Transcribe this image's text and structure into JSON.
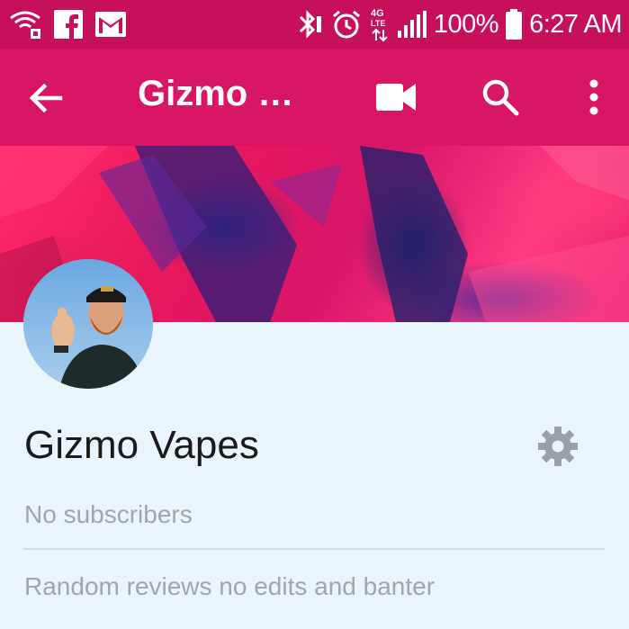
{
  "status_bar": {
    "battery": "100%",
    "time": "6:27 AM",
    "network": "4G LTE",
    "icons": [
      "wifi-call-icon",
      "facebook-icon",
      "gmail-icon",
      "bluetooth-icon",
      "alarm-icon",
      "lte-icon",
      "signal-icon",
      "battery-icon"
    ]
  },
  "app_bar": {
    "title": "Gizmo V…",
    "icons": [
      "back-arrow-icon",
      "video-camera-icon",
      "search-icon",
      "more-vert-icon"
    ]
  },
  "channel": {
    "name": "Gizmo Vapes",
    "subscribers": "No subscribers",
    "description": "Random reviews no edits and banter",
    "settings_icon": "gear-icon"
  },
  "colors": {
    "status_bar": "#c6105a",
    "app_bar": "#d81663",
    "background": "#eaf4fb",
    "secondary_text": "#a0a6ab"
  }
}
